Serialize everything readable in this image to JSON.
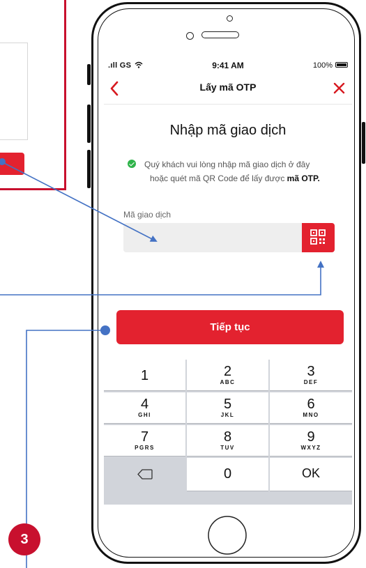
{
  "status_bar": {
    "carrier": ".ıll GS",
    "time": "9:41 AM",
    "battery": "100%"
  },
  "nav": {
    "back_icon": "chevron-left-icon",
    "title": "Lấy mã OTP",
    "close_icon": "close-icon"
  },
  "heading": "Nhập mã giao dịch",
  "note": {
    "line1": "Quý khách vui lòng nhập mã giao dịch ở đây",
    "line2_prefix": "hoặc quét mã QR Code để lấy được ",
    "line2_bold": "mã OTP."
  },
  "field": {
    "label": "Mã giao dịch",
    "value": "",
    "placeholder": ""
  },
  "continue_label": "Tiếp tục",
  "keypad": {
    "rows": [
      [
        {
          "num": "1",
          "letters": ""
        },
        {
          "num": "2",
          "letters": "ABC"
        },
        {
          "num": "3",
          "letters": "DEF"
        }
      ],
      [
        {
          "num": "4",
          "letters": "GHI"
        },
        {
          "num": "5",
          "letters": "JKL"
        },
        {
          "num": "6",
          "letters": "MNO"
        }
      ],
      [
        {
          "num": "7",
          "letters": "PGRS"
        },
        {
          "num": "8",
          "letters": "TUV"
        },
        {
          "num": "9",
          "letters": "WXYZ"
        }
      ]
    ],
    "zero": "0",
    "ok": "OK"
  },
  "badge": "3",
  "colors": {
    "brand_red": "#e3222f",
    "annotation_blue": "#4472c4",
    "check_green": "#2fb34a"
  }
}
